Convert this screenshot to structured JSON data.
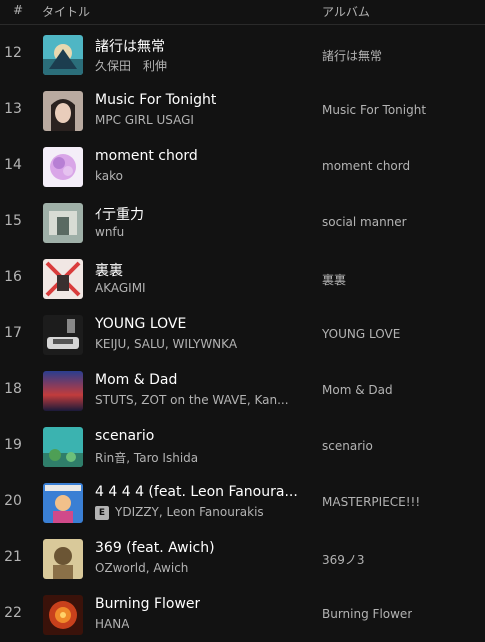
{
  "header": {
    "num_label": "#",
    "title_label": "タイトル",
    "album_label": "アルバム"
  },
  "tracks": [
    {
      "num": "12",
      "title": "諸行は無常",
      "artist": "久保田　利伸",
      "album": "諸行は無常",
      "explicit": false
    },
    {
      "num": "13",
      "title": "Music For Tonight",
      "artist": "MPC GIRL USAGI",
      "album": "Music For Tonight",
      "explicit": false
    },
    {
      "num": "14",
      "title": "moment chord",
      "artist": "kako",
      "album": "moment chord",
      "explicit": false
    },
    {
      "num": "15",
      "title": "ｲ亍重力",
      "artist": "wnfu",
      "album": "social manner",
      "explicit": false
    },
    {
      "num": "16",
      "title": "裏裏",
      "artist": "AKAGIMI",
      "album": "裏裏",
      "explicit": false
    },
    {
      "num": "17",
      "title": "YOUNG LOVE",
      "artist": "KEIJU, SALU, WILYWNKA",
      "album": "YOUNG LOVE",
      "explicit": false
    },
    {
      "num": "18",
      "title": "Mom & Dad",
      "artist": "STUTS, ZOT on the WAVE, Kan...",
      "album": "Mom & Dad",
      "explicit": false
    },
    {
      "num": "19",
      "title": "scenario",
      "artist": "Rin音, Taro Ishida",
      "album": "scenario",
      "explicit": false
    },
    {
      "num": "20",
      "title": "4 4 4 4 (feat. Leon Fanoura...",
      "artist": "YDIZZY, Leon Fanourakis",
      "album": "MASTERPIECE!!!",
      "explicit": true,
      "badge": "E"
    },
    {
      "num": "21",
      "title": "369 (feat. Awich)",
      "artist": "OZworld, Awich",
      "album": "369ノ3",
      "explicit": false
    },
    {
      "num": "22",
      "title": "Burning Flower",
      "artist": "HANA",
      "album": "Burning Flower",
      "explicit": false
    }
  ],
  "colors": {
    "background": "#121212",
    "primary_text": "#ffffff",
    "secondary_text": "#b3b3b3"
  }
}
